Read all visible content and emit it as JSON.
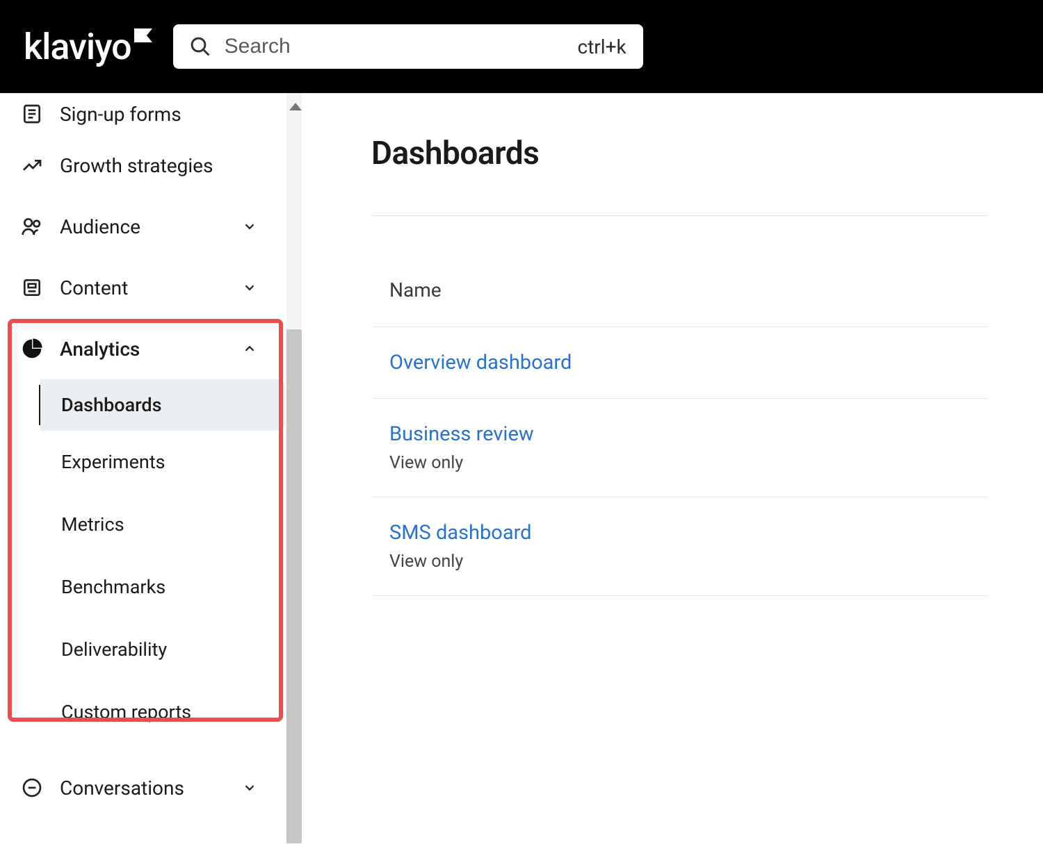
{
  "logo_text": "klaviyo",
  "search": {
    "placeholder": "Search",
    "shortcut": "ctrl+k"
  },
  "sidebar": {
    "items": [
      {
        "label": "Sign-up forms"
      },
      {
        "label": "Growth strategies"
      },
      {
        "label": "Audience"
      },
      {
        "label": "Content"
      },
      {
        "label": "Analytics"
      },
      {
        "label": "Conversations"
      }
    ],
    "analytics_subitems": [
      {
        "label": "Dashboards"
      },
      {
        "label": "Experiments"
      },
      {
        "label": "Metrics"
      },
      {
        "label": "Benchmarks"
      },
      {
        "label": "Deliverability"
      },
      {
        "label": "Custom reports"
      }
    ]
  },
  "main": {
    "title": "Dashboards",
    "column_header": "Name",
    "rows": [
      {
        "name": "Overview dashboard",
        "sub": ""
      },
      {
        "name": "Business review",
        "sub": "View only"
      },
      {
        "name": "SMS dashboard",
        "sub": "View only"
      }
    ]
  }
}
